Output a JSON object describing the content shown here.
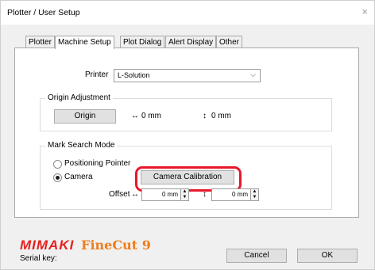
{
  "window": {
    "title": "Plotter / User Setup",
    "close_glyph": "×"
  },
  "tabs": [
    {
      "label": "Plotter",
      "active": false
    },
    {
      "label": "Machine Setup",
      "active": true
    },
    {
      "label": "Plot Dialog",
      "active": false
    },
    {
      "label": "Alert Display",
      "active": false
    },
    {
      "label": "Other",
      "active": false
    }
  ],
  "printer": {
    "label": "Printer",
    "value": "L-Solution"
  },
  "origin_adjustment": {
    "title": "Origin Adjustment",
    "button": "Origin",
    "x_value": "0 mm",
    "y_value": "0 mm"
  },
  "mark_search": {
    "title": "Mark Search Mode",
    "option_pointer": "Positioning Pointer",
    "option_camera": "Camera",
    "selected": "Camera",
    "calibration_button": "Camera Calibration",
    "offset_label": "Offset",
    "offset_x": "0 mm",
    "offset_y": "0 mm"
  },
  "footer": {
    "brand": "MIMAKI",
    "product": "FineCut 9",
    "serial_label": "Serial key:",
    "cancel": "Cancel",
    "ok": "OK"
  },
  "colors": {
    "brand_red": "#e6211e",
    "highlight": "#e8182a",
    "product_orange": "#ee7d1c"
  }
}
